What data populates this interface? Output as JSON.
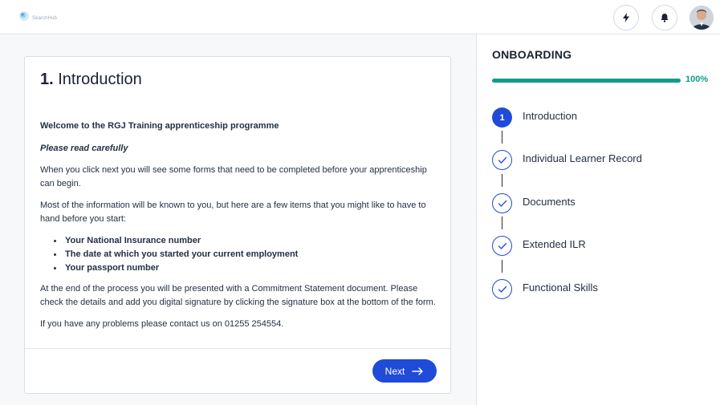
{
  "header": {
    "brand": "SearchHub",
    "icons": [
      "lightning-icon",
      "bell-icon",
      "user-avatar"
    ]
  },
  "intro": {
    "number": "1.",
    "title": "Introduction",
    "heading": "Welcome to the RGJ Training apprenticeship programme",
    "subheading": "Please read carefully",
    "paragraph1": "When you click next you will see some forms that need to be completed before your apprenticeship can begin.",
    "paragraph2": "Most of the information will be known to you, but here are a few items that you might like to have to hand before you start:",
    "bullets": [
      "Your National Insurance number",
      "The date at which you started your current employment",
      "Your passport number"
    ],
    "paragraph3": "At the end of the process you will be presented with a Commitment Statement document. Please check the details and add you digital signature by clicking the signature box at the bottom of the form.",
    "paragraph4": "If you have any problems please contact us on 01255 254554.",
    "next_label": "Next"
  },
  "onboarding": {
    "title": "ONBOARDING",
    "progress": 100,
    "progress_label": "100%",
    "steps": [
      {
        "label": "Introduction",
        "state": "active",
        "number": "1"
      },
      {
        "label": "Individual Learner Record",
        "state": "done"
      },
      {
        "label": "Documents",
        "state": "done"
      },
      {
        "label": "Extended ILR",
        "state": "done"
      },
      {
        "label": "Functional Skills",
        "state": "done"
      }
    ]
  },
  "colors": {
    "accent": "#1f4bd8",
    "progress": "#129b8a",
    "text": "#1b2231"
  }
}
